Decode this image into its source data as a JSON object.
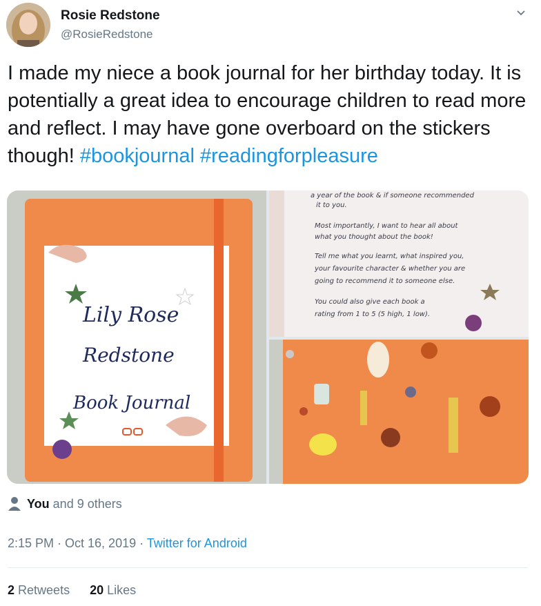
{
  "author": {
    "name": "Rosie Redstone",
    "handle": "@RosieRedstone"
  },
  "tweet": {
    "text": "I made my niece a book journal for her birthday today. It is potentially a great idea to encourage children to read more and reflect. I may have gone overboard on the stickers though! ",
    "hashtags": [
      "#bookjournal",
      "#readingforpleasure"
    ]
  },
  "media": {
    "cover_lines": [
      "Lily Rose",
      "Redstone",
      "Book Journal"
    ],
    "page_lines": [
      "a year of the book & if someone recommended",
      "it to you.",
      "Most importantly, I want to hear all about",
      "what you thought about the book!",
      "Tell me what you learnt, what inspired you,",
      "your favourite character & whether you are",
      "going to recommend it to someone else.",
      "You could also give each book a",
      "rating from 1 to 5 (5 high, 1 low)."
    ]
  },
  "likers": {
    "first": "You",
    "rest": "and 9 others"
  },
  "meta": {
    "time": "2:15 PM · Oct 16, 2019 · ",
    "source": "Twitter for Android"
  },
  "stats": {
    "retweets_count": "2",
    "retweets_label": "Retweets",
    "likes_count": "20",
    "likes_label": "Likes"
  },
  "colors": {
    "link": "#1b95e0",
    "secondary": "#657786",
    "notebook_orange": "#f08a4b"
  }
}
